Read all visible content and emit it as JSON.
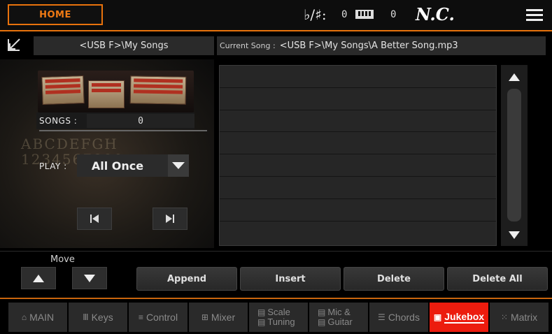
{
  "topbar": {
    "home_label": "HOME",
    "transpose_icon": "♭/♯:",
    "transpose_value": "0",
    "octave_value": "0",
    "chord": "N.C.",
    "menu_icon": "menu-icon"
  },
  "path": {
    "current_folder": "<USB F>\\My Songs",
    "current_song_label": "Current Song :",
    "current_song": "<USB F>\\My Songs\\A Better Song.mp3"
  },
  "left": {
    "songs_label": "SONGS :",
    "songs_count": "0",
    "play_label": "PLAY :",
    "play_mode": "All Once",
    "background_letters": "ABCDEFGH\n1234567890"
  },
  "list": {
    "rows": [
      "",
      "",
      "",
      "",
      "",
      "",
      "",
      ""
    ]
  },
  "actions": {
    "move_label": "Move",
    "append": "Append",
    "insert": "Insert",
    "delete": "Delete",
    "delete_all": "Delete All"
  },
  "tabs": [
    {
      "label": "MAIN",
      "icon": "home-icon"
    },
    {
      "label": "Keys",
      "icon": "keys-icon"
    },
    {
      "label": "Control",
      "icon": "control-icon"
    },
    {
      "label": "Mixer",
      "icon": "mixer-icon"
    },
    {
      "line1": "Scale",
      "line2": "Tuning",
      "icon": "scale-icon"
    },
    {
      "line1": "Mic &",
      "line2": "Guitar",
      "icon": "mic-icon"
    },
    {
      "label": "Chords",
      "icon": "chords-icon"
    },
    {
      "label": "Jukebox",
      "icon": "jukebox-icon",
      "active": true
    },
    {
      "label": "Matrix",
      "icon": "matrix-icon"
    }
  ],
  "colors": {
    "accent": "#e8720c",
    "active_tab": "#ec1c0e"
  }
}
